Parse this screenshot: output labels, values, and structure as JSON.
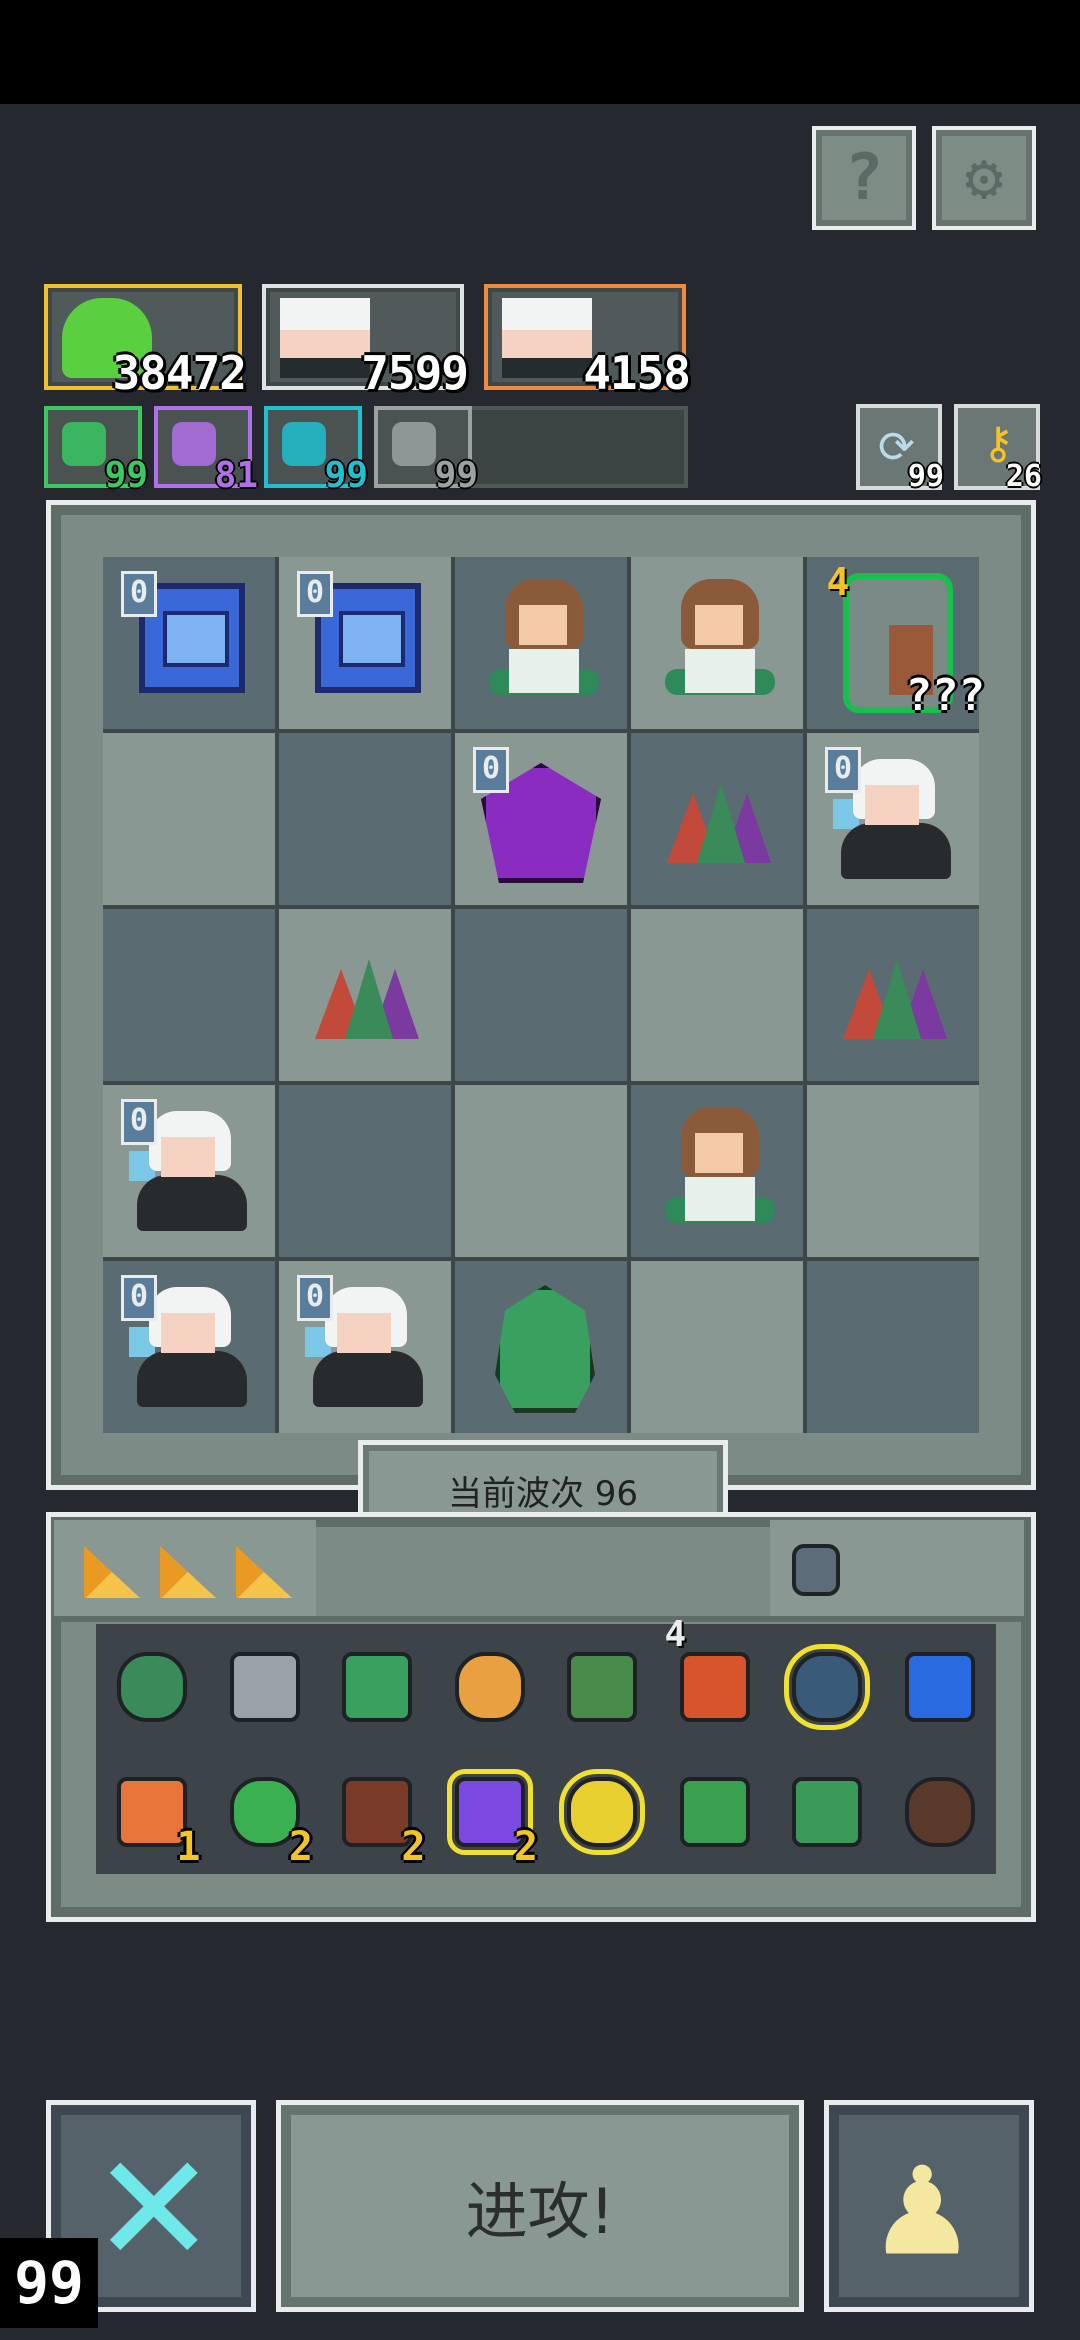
{
  "resources": [
    {
      "name": "slime",
      "value": "38472",
      "border": "#f0c030"
    },
    {
      "name": "witch-a",
      "value": "7599",
      "border": "#dce4e4"
    },
    {
      "name": "witch-b",
      "value": "4158",
      "border": "#f08a40"
    }
  ],
  "stats": [
    {
      "icon": "seed-icon",
      "value": "99",
      "color": "#3ac860"
    },
    {
      "icon": "lightning-icon",
      "value": "81",
      "color": "#b070e8"
    },
    {
      "icon": "spiral-icon",
      "value": "99",
      "color": "#20c0d0"
    },
    {
      "icon": "gun-icon",
      "value": "99",
      "color": "#9aa2a2"
    }
  ],
  "corner": {
    "refresh": "99",
    "key": "26"
  },
  "header_buttons": {
    "help": "?",
    "settings": "⚙"
  },
  "board": {
    "cells": [
      {
        "unit": "chest",
        "level": "0",
        "tone": "d"
      },
      {
        "unit": "chest",
        "level": "0",
        "tone": "l"
      },
      {
        "unit": "girl",
        "level": "",
        "tone": "d"
      },
      {
        "unit": "girl",
        "level": "",
        "tone": "l"
      },
      {
        "unit": "armor",
        "level": "4",
        "tone": "d",
        "label": "???"
      },
      {
        "unit": "",
        "level": "",
        "tone": "l"
      },
      {
        "unit": "",
        "level": "",
        "tone": "d"
      },
      {
        "unit": "dragon",
        "level": "0",
        "tone": "l"
      },
      {
        "unit": "crystal",
        "level": "",
        "tone": "d"
      },
      {
        "unit": "witch",
        "level": "0",
        "tone": "l"
      },
      {
        "unit": "",
        "level": "",
        "tone": "d"
      },
      {
        "unit": "crystal",
        "level": "",
        "tone": "l"
      },
      {
        "unit": "",
        "level": "",
        "tone": "d"
      },
      {
        "unit": "",
        "level": "",
        "tone": "l"
      },
      {
        "unit": "crystal",
        "level": "",
        "tone": "d"
      },
      {
        "unit": "witch",
        "level": "0",
        "tone": "l"
      },
      {
        "unit": "",
        "level": "",
        "tone": "d"
      },
      {
        "unit": "",
        "level": "",
        "tone": "l"
      },
      {
        "unit": "girl",
        "level": "",
        "tone": "d"
      },
      {
        "unit": "",
        "level": "",
        "tone": "l"
      },
      {
        "unit": "witch",
        "level": "0",
        "tone": "d"
      },
      {
        "unit": "witch",
        "level": "0",
        "tone": "l"
      },
      {
        "unit": "knight",
        "level": "",
        "tone": "d"
      },
      {
        "unit": "",
        "level": "",
        "tone": "l"
      },
      {
        "unit": "",
        "level": "",
        "tone": "d"
      }
    ]
  },
  "wave": {
    "label": "当前波次 96"
  },
  "inventory": {
    "tabs": [
      "cheese-icon",
      "cheese-icon",
      "cheese-icon"
    ],
    "side_icon": "bag-icon",
    "items": [
      {
        "icon": "turtle-shell-icon",
        "color": "#3a8a5a",
        "count": "",
        "badge": ""
      },
      {
        "icon": "hammer-icon",
        "color": "#9aa2a8",
        "count": "",
        "badge": ""
      },
      {
        "icon": "potion-jar-icon",
        "color": "#3aa060",
        "count": "",
        "badge": ""
      },
      {
        "icon": "claw-icon",
        "color": "#e8a040",
        "count": "",
        "badge": ""
      },
      {
        "icon": "arrow-icon",
        "color": "#4a8a4a",
        "count": "",
        "badge": ""
      },
      {
        "icon": "scroll-icon",
        "color": "#d8542a",
        "count": "",
        "badge": "4"
      },
      {
        "icon": "spike-trap-icon",
        "color": "#3a5a7a",
        "count": "",
        "badge": "",
        "selected": true
      },
      {
        "icon": "water-drop-icon",
        "color": "#2a6ae0",
        "count": "",
        "badge": ""
      },
      {
        "icon": "axe-icon",
        "color": "#e8763a",
        "count": "1",
        "badge": ""
      },
      {
        "icon": "vine-icon",
        "color": "#3ab050",
        "count": "2",
        "badge": ""
      },
      {
        "icon": "stump-icon",
        "color": "#7a3a2a",
        "count": "2",
        "badge": ""
      },
      {
        "icon": "jar-icon",
        "color": "#7a4ae0",
        "count": "2",
        "badge": "",
        "selected": true
      },
      {
        "icon": "goblet-icon",
        "color": "#e8d030",
        "count": "",
        "badge": "",
        "selected": true
      },
      {
        "icon": "leaf-blade-icon",
        "color": "#3aa050",
        "count": "",
        "badge": ""
      },
      {
        "icon": "chest-mimic-icon",
        "color": "#3a9a5a",
        "count": "",
        "badge": ""
      },
      {
        "icon": "rock-crystal-icon",
        "color": "#5a3a2a",
        "count": "",
        "badge": ""
      }
    ]
  },
  "actions": {
    "attack": "进攻!",
    "counter": "99"
  }
}
